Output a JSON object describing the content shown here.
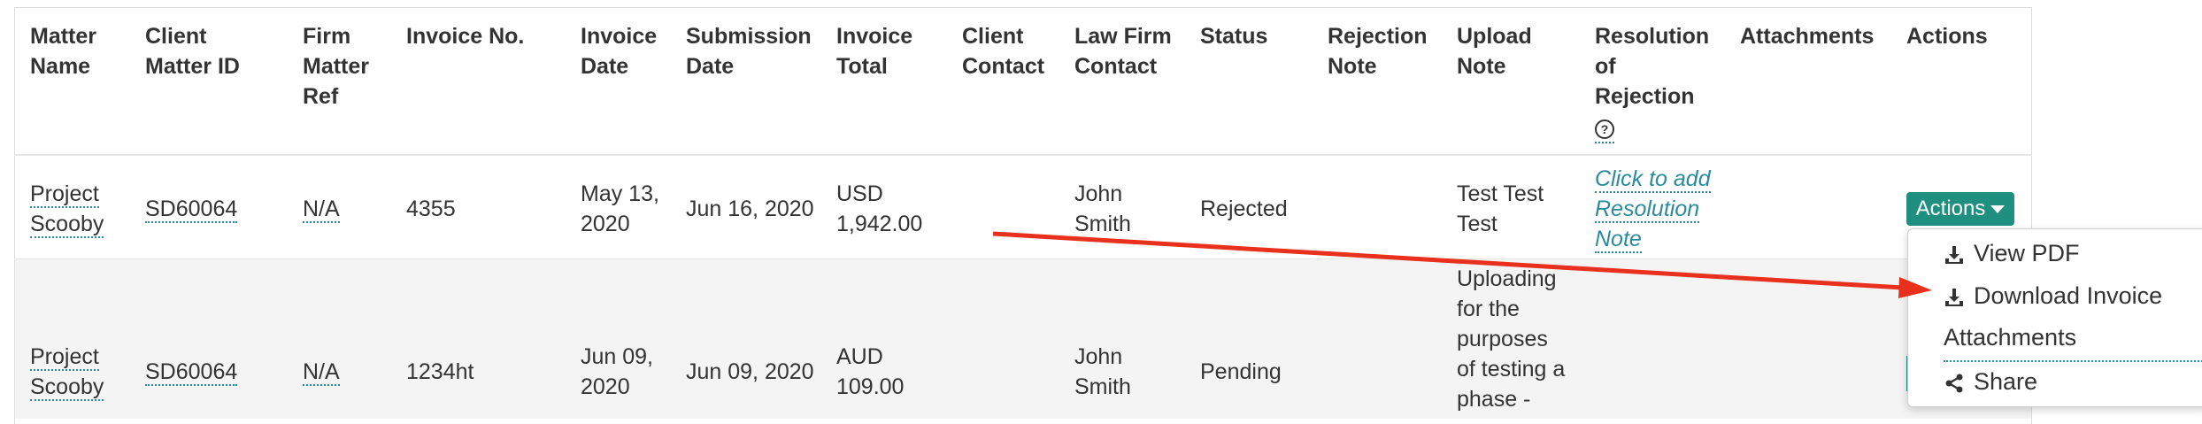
{
  "headers": {
    "matter_name": [
      "Matter",
      "Name"
    ],
    "client_matter_id": [
      "Client",
      "Matter ID"
    ],
    "firm_matter_ref": [
      "Firm",
      "Matter",
      "Ref"
    ],
    "invoice_no": [
      "Invoice No."
    ],
    "invoice_date": [
      "Invoice",
      "Date"
    ],
    "submission_date": [
      "Submission",
      "Date"
    ],
    "invoice_total": [
      "Invoice",
      "Total"
    ],
    "client_contact": [
      "Client",
      "Contact"
    ],
    "law_firm_contact": [
      "Law Firm",
      "Contact"
    ],
    "status": [
      "Status"
    ],
    "rejection_note": [
      "Rejection",
      "Note"
    ],
    "upload_note": [
      "Upload",
      "Note"
    ],
    "resolution": [
      "Resolution",
      "of",
      "Rejection"
    ],
    "attachments": [
      "Attachments"
    ],
    "actions": [
      "Actions"
    ]
  },
  "rows": [
    {
      "matter_name": [
        "Project",
        "Scooby"
      ],
      "client_matter_id": "SD60064",
      "firm_matter_ref": "N/A",
      "invoice_no": "4355",
      "invoice_date": [
        "May 13,",
        "2020"
      ],
      "submission_date": "Jun 16, 2020",
      "invoice_total": [
        "USD",
        "1,942.00"
      ],
      "law_firm_contact": [
        "John",
        "Smith"
      ],
      "status": "Rejected",
      "upload_note": [
        "Test Test",
        "Test"
      ],
      "resolution": [
        "Click to add",
        "Resolution",
        "Note"
      ]
    },
    {
      "matter_name": [
        "Project",
        "Scooby"
      ],
      "client_matter_id": "SD60064",
      "firm_matter_ref": "N/A",
      "invoice_no": "1234ht",
      "invoice_date": [
        "Jun 09,",
        "2020"
      ],
      "submission_date": "Jun 09, 2020",
      "invoice_total": [
        "AUD",
        "109.00"
      ],
      "law_firm_contact": [
        "John",
        "Smith"
      ],
      "status": "Pending",
      "upload_note": [
        "Uploading",
        "for the",
        "purposes",
        "of testing a",
        "phase -"
      ]
    }
  ],
  "actions_button": "Actions",
  "dropdown": {
    "view_pdf": "View PDF",
    "download_invoice": "Download Invoice",
    "attachments": "Attachments",
    "share": "Share"
  },
  "colors": {
    "accent": "#1f8f80",
    "link": "#2b8a9b",
    "annotation_arrow": "#e8301c"
  }
}
